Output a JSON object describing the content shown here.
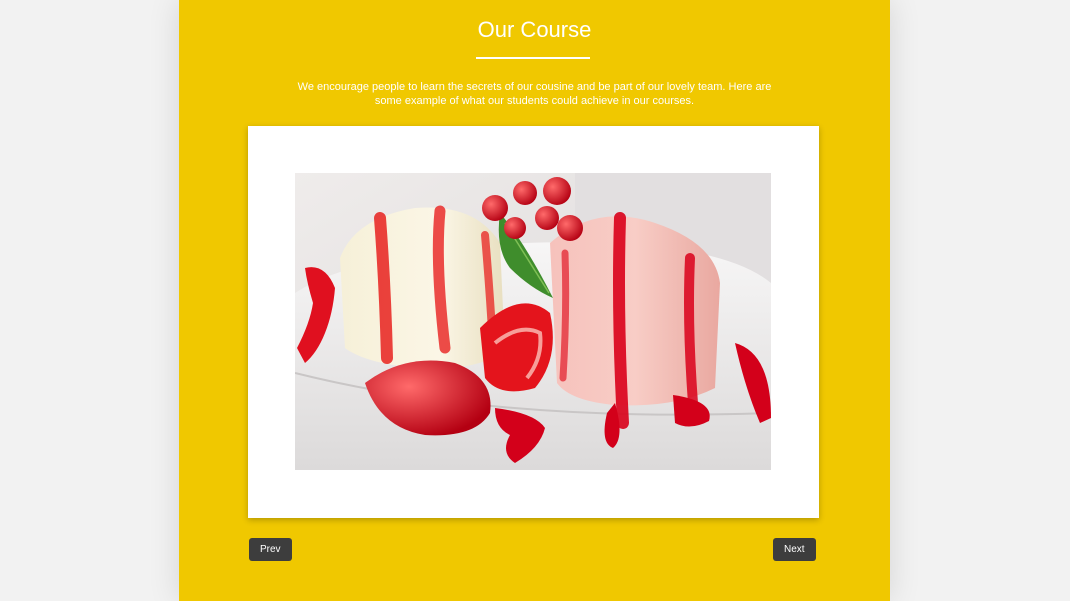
{
  "section": {
    "title": "Our Course",
    "description": "We encourage people to learn the secrets of our cousine and be part of our lovely team. Here are some example of what our students could achieve in our courses."
  },
  "slider": {
    "current_image": "strawberry-panna-cotta-dessert-photo",
    "prev_label": "Prev",
    "next_label": "Next"
  },
  "colors": {
    "page_background": "#f2f2f2",
    "panel_background": "#f0c800",
    "button_background": "#3d3d3d",
    "text": "#ffffff"
  }
}
